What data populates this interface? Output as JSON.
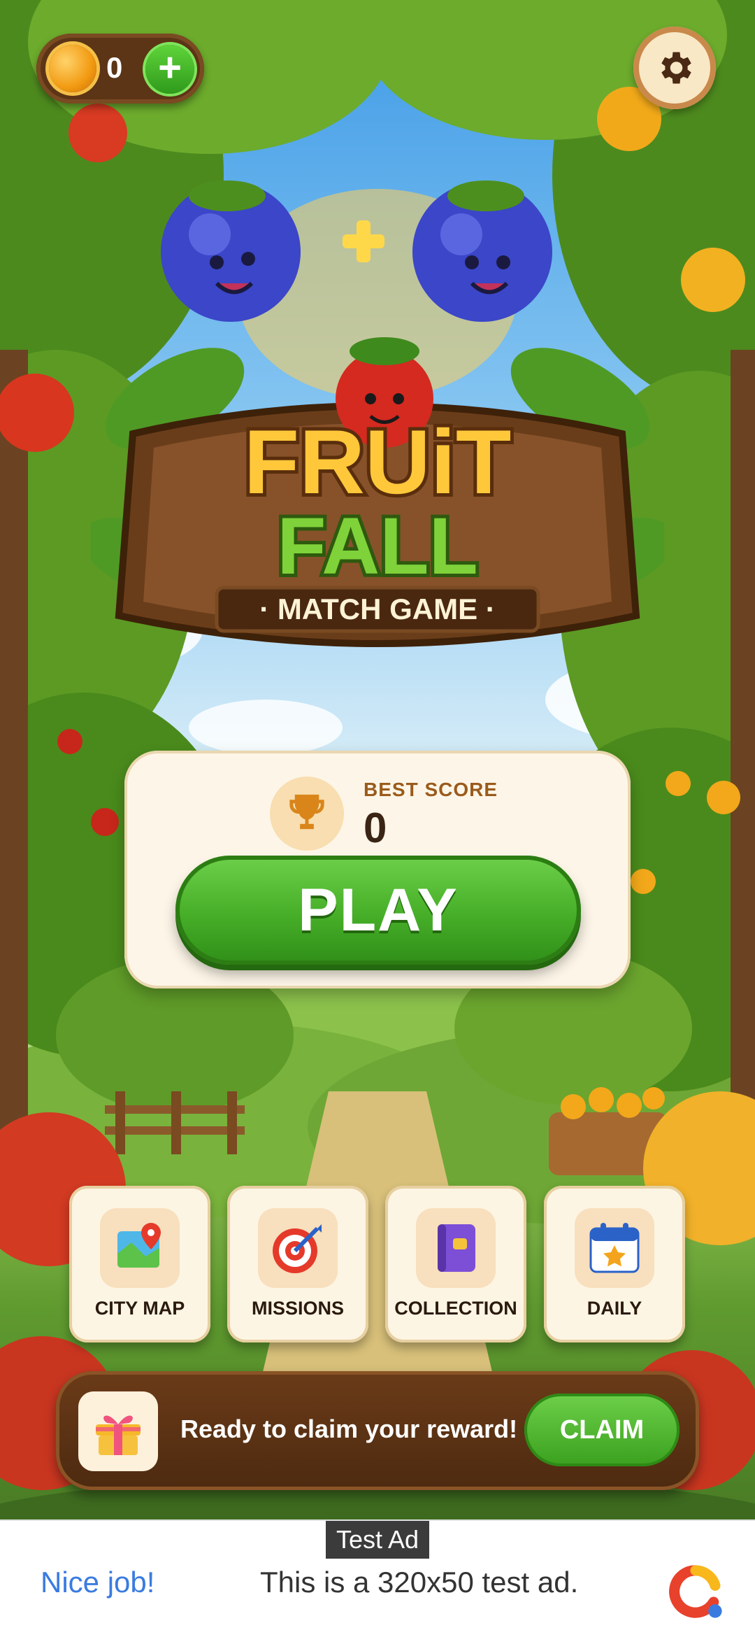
{
  "topbar": {
    "coin_count": "0",
    "add_coins": "+"
  },
  "logo": {
    "line1": "FRUiT",
    "line2": "FALL",
    "tagline": "· MATCH GAME ·"
  },
  "score_card": {
    "label": "BEST SCORE",
    "value": "0",
    "play_label": "PLAY"
  },
  "menu": [
    {
      "label": "CITY MAP",
      "icon": "map-icon"
    },
    {
      "label": "MISSIONS",
      "icon": "target-icon"
    },
    {
      "label": "COLLECTION",
      "icon": "book-icon"
    },
    {
      "label": "DAILY",
      "icon": "calendar-star-icon"
    }
  ],
  "reward": {
    "text": "Ready to claim your reward!",
    "claim_label": "CLAIM"
  },
  "ad": {
    "tag": "Test Ad",
    "headline": "Nice job!",
    "body": "This is a 320x50 test ad."
  },
  "colors": {
    "play_green": "#46ae28",
    "wood_brown": "#5c3416",
    "cream": "#fdf6e8"
  }
}
